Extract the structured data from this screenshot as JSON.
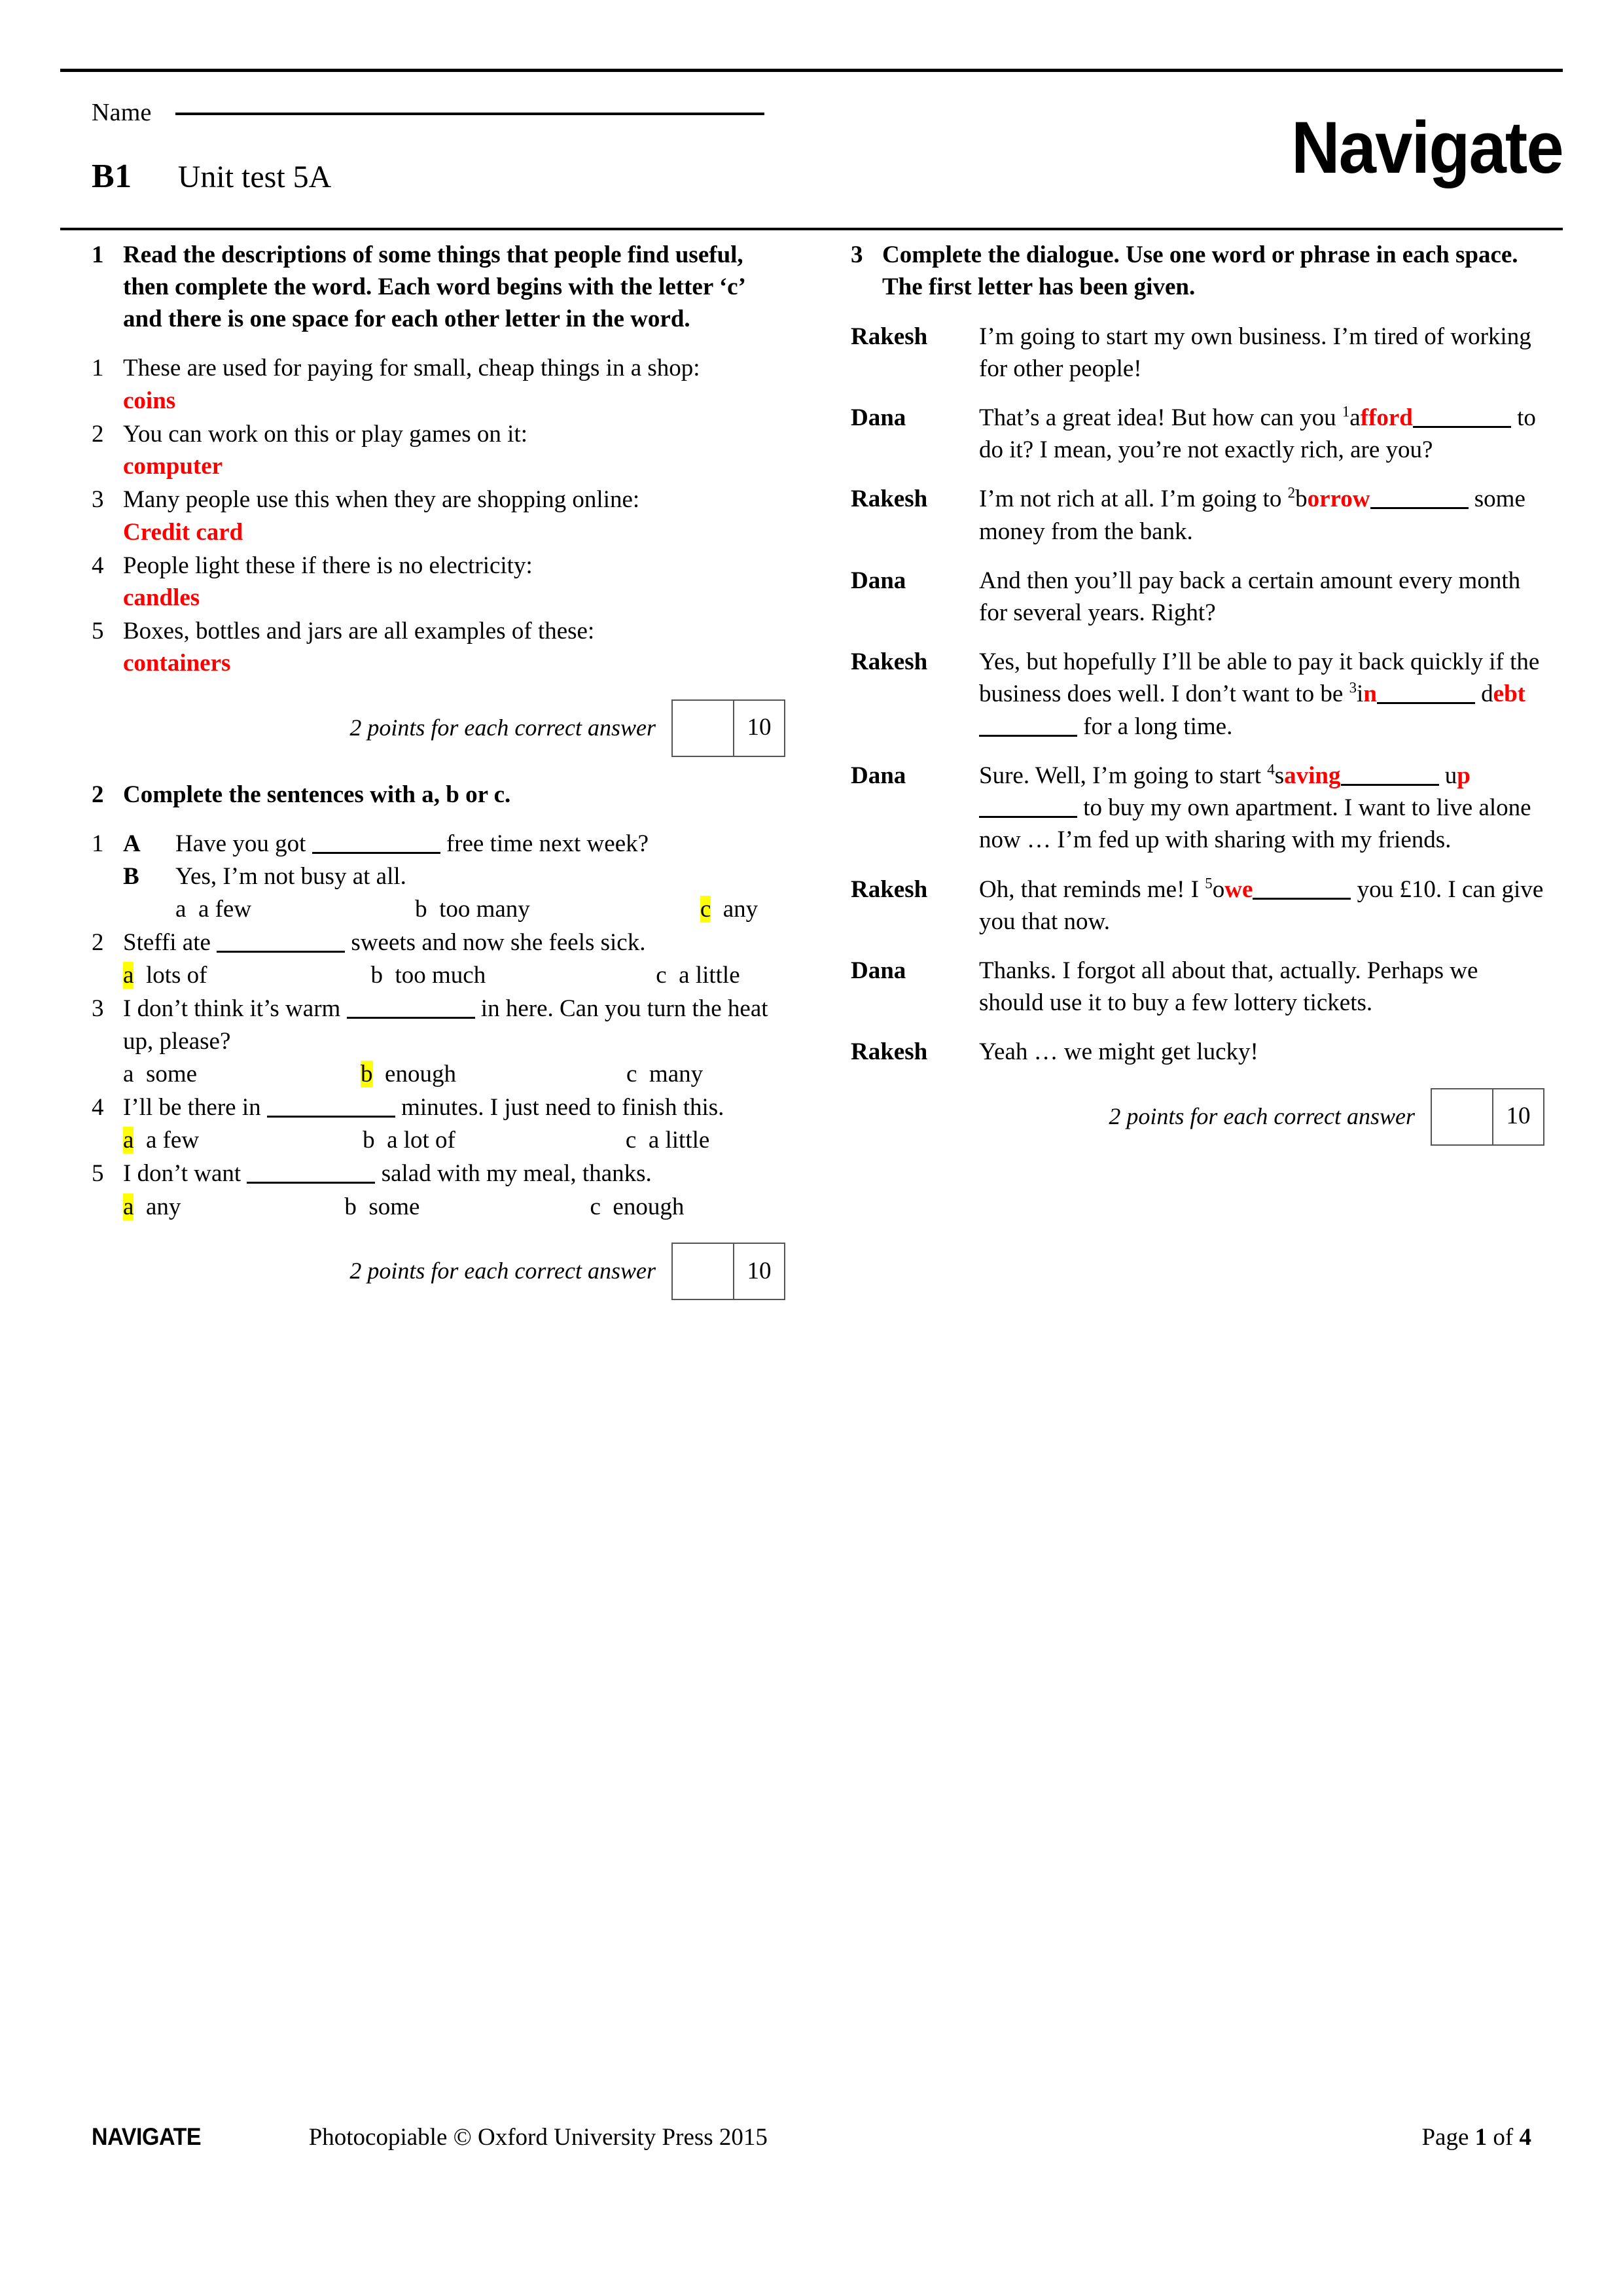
{
  "header": {
    "name_label": "Name",
    "level": "B1",
    "title": "Unit test 5A",
    "logo": "Navigate"
  },
  "exercise1": {
    "number": "1",
    "instruction": "Read the descriptions of some things that people find useful, then complete the word. Each word begins with the letter ‘c’ and there is one space for each other letter in the word.",
    "items": [
      {
        "num": "1",
        "text": "These are used for paying for small, cheap things in a shop:",
        "answer": "coins"
      },
      {
        "num": "2",
        "text": "You can work on this or play games on it:",
        "answer": "computer"
      },
      {
        "num": "3",
        "text": "Many people use this when they are shopping online:",
        "answer": "Credit card"
      },
      {
        "num": "4",
        "text": "People light these if there is no electricity:",
        "answer": "candles"
      },
      {
        "num": "5",
        "text": "Boxes, bottles and jars are all examples of these:",
        "answer": "containers"
      }
    ],
    "points_label": "2 points for each correct answer",
    "points_value": "10"
  },
  "exercise2": {
    "number": "2",
    "instruction": "Complete the sentences with a, b or c.",
    "items": [
      {
        "num": "1",
        "speaker_a_label": "A",
        "speaker_a_text_before": "Have you got",
        "speaker_a_text_after": "free time next week?",
        "speaker_b_label": "B",
        "speaker_b_text": "Yes, I’m not busy at all.",
        "options": [
          {
            "letter": "a",
            "text": "a few",
            "selected": false
          },
          {
            "letter": "b",
            "text": "too many",
            "selected": false
          },
          {
            "letter": "c",
            "text": "any",
            "selected": true
          }
        ]
      },
      {
        "num": "2",
        "text_before": "Steffi ate",
        "text_after": "sweets and now she feels sick.",
        "options": [
          {
            "letter": "a",
            "text": "lots of",
            "selected": true
          },
          {
            "letter": "b",
            "text": "too much",
            "selected": false
          },
          {
            "letter": "c",
            "text": "a little",
            "selected": false
          }
        ]
      },
      {
        "num": "3",
        "text_before": "I don’t think it’s warm",
        "text_after": "in here. Can you turn the heat up, please?",
        "options": [
          {
            "letter": "a",
            "text": "some",
            "selected": false
          },
          {
            "letter": "b",
            "text": "enough",
            "selected": true
          },
          {
            "letter": "c",
            "text": "many",
            "selected": false
          }
        ]
      },
      {
        "num": "4",
        "text_before": "I’ll be there in",
        "text_after": "minutes. I just need to finish this.",
        "options": [
          {
            "letter": "a",
            "text": "a few",
            "selected": true
          },
          {
            "letter": "b",
            "text": "a lot of",
            "selected": false
          },
          {
            "letter": "c",
            "text": "a little",
            "selected": false
          }
        ]
      },
      {
        "num": "5",
        "text_before": "I don’t want",
        "text_after": "salad with my meal, thanks.",
        "options": [
          {
            "letter": "a",
            "text": "any",
            "selected": true
          },
          {
            "letter": "b",
            "text": "some",
            "selected": false
          },
          {
            "letter": "c",
            "text": "enough",
            "selected": false
          }
        ]
      }
    ],
    "points_label": "2 points for each correct answer",
    "points_value": "10"
  },
  "exercise3": {
    "number": "3",
    "instruction": "Complete the dialogue. Use one word or phrase in each space. The first letter has been given.",
    "lines": [
      {
        "speaker": "Rakesh",
        "text": "I’m going to start my own business. I’m tired of working for other people!"
      },
      {
        "speaker": "Dana",
        "gap_number": "1",
        "prefix": "That’s a great idea! But how can you ",
        "given_letter": "a",
        "answer": "fford",
        "suffix": " to do it? I mean, you’re not exactly rich, are you?"
      },
      {
        "speaker": "Rakesh",
        "gap_number": "2",
        "prefix": "I’m not rich at all. I’m going to ",
        "given_letter": "b",
        "answer": "orrow",
        "suffix": " some money from the bank."
      },
      {
        "speaker": "Dana",
        "text": "And then you’ll pay back a certain amount every month for several years. Right?"
      },
      {
        "speaker": "Rakesh",
        "gap_number": "3",
        "prefix": "Yes, but hopefully I’ll be able to pay it back quickly if the business does well. I don’t want to be ",
        "given_letter": "i",
        "answer": "n",
        "mid": " d",
        "answer2": "ebt",
        "suffix": " for a long time."
      },
      {
        "speaker": "Dana",
        "gap_number": "4",
        "prefix": "Sure. Well, I’m going to start ",
        "given_letter": "s",
        "answer": "aving",
        "mid": " u",
        "answer2": "p",
        "suffix": " to buy my own apartment. I want to live alone now … I’m fed up with sharing with my friends."
      },
      {
        "speaker": "Rakesh",
        "gap_number": "5",
        "prefix": "Oh, that reminds me! I ",
        "given_letter": "o",
        "answer": "we",
        "suffix": " you £10. I can give you that now."
      },
      {
        "speaker": "Dana",
        "text": "Thanks. I forgot all about that, actually. Perhaps we should use it to buy a few lottery tickets."
      },
      {
        "speaker": "Rakesh",
        "text": "Yeah … we might get lucky!"
      }
    ],
    "points_label": "2 points for each correct answer",
    "points_value": "10"
  },
  "footer": {
    "brand": "NAVIGATE",
    "copyright": "Photocopiable © Oxford University Press 2015",
    "page_prefix": "Page",
    "page_current": "1",
    "page_middle": "of",
    "page_total": "4"
  },
  "colors": {
    "answer_red": "#FF0000",
    "highlight_yellow": "#FFFF00"
  }
}
